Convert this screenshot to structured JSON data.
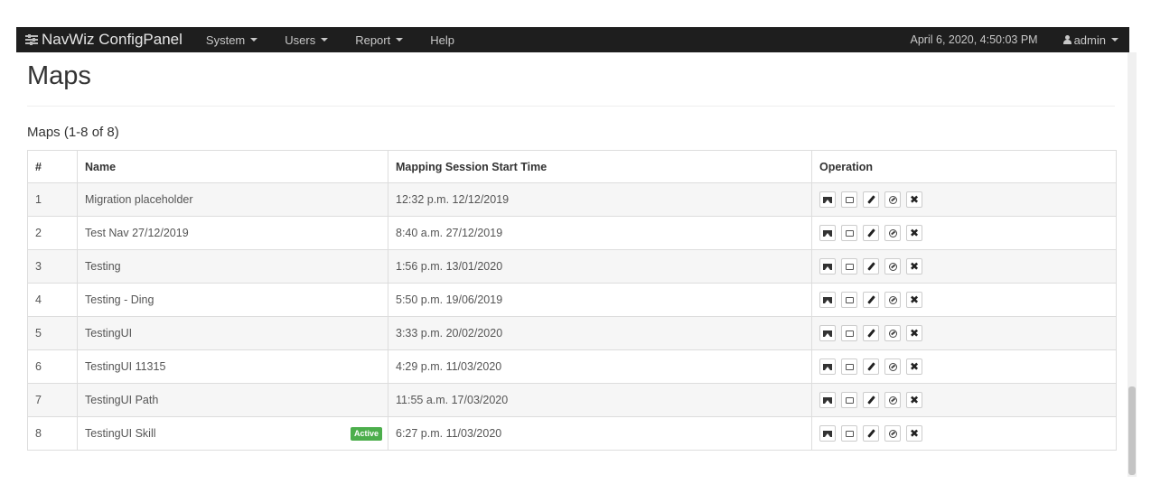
{
  "navbar": {
    "brand": "NavWiz ConfigPanel",
    "menu": [
      {
        "label": "System",
        "dropdown": true
      },
      {
        "label": "Users",
        "dropdown": true
      },
      {
        "label": "Report",
        "dropdown": true
      },
      {
        "label": "Help",
        "dropdown": false
      }
    ],
    "datetime": "April 6, 2020, 4:50:03 PM",
    "user": "admin"
  },
  "page": {
    "title": "Maps",
    "section_title": "Maps (1-8 of 8)"
  },
  "table": {
    "headers": {
      "index": "#",
      "name": "Name",
      "start_time": "Mapping Session Start Time",
      "operation": "Operation"
    },
    "rows": [
      {
        "index": "1",
        "name": "Migration placeholder",
        "start_time": "12:32 p.m. 12/12/2019",
        "badge": ""
      },
      {
        "index": "2",
        "name": "Test Nav 27/12/2019",
        "start_time": "8:40 a.m. 27/12/2019",
        "badge": ""
      },
      {
        "index": "3",
        "name": "Testing",
        "start_time": "1:56 p.m. 13/01/2020",
        "badge": ""
      },
      {
        "index": "4",
        "name": "Testing - Ding",
        "start_time": "5:50 p.m. 19/06/2019",
        "badge": ""
      },
      {
        "index": "5",
        "name": "TestingUI",
        "start_time": "3:33 p.m. 20/02/2020",
        "badge": ""
      },
      {
        "index": "6",
        "name": "TestingUI 11315",
        "start_time": "4:29 p.m. 11/03/2020",
        "badge": ""
      },
      {
        "index": "7",
        "name": "TestingUI Path",
        "start_time": "11:55 a.m. 17/03/2020",
        "badge": ""
      },
      {
        "index": "8",
        "name": "TestingUI Skill",
        "start_time": "6:27 p.m. 11/03/2020",
        "badge": "Active"
      }
    ],
    "operation_icons": [
      "image-icon",
      "map-icon",
      "pencil-icon",
      "duplicate-icon",
      "delete-icon"
    ]
  },
  "colors": {
    "navbar_bg": "#1e1e1e",
    "badge_active": "#4cae4c",
    "row_stripe": "#f6f6f6"
  }
}
